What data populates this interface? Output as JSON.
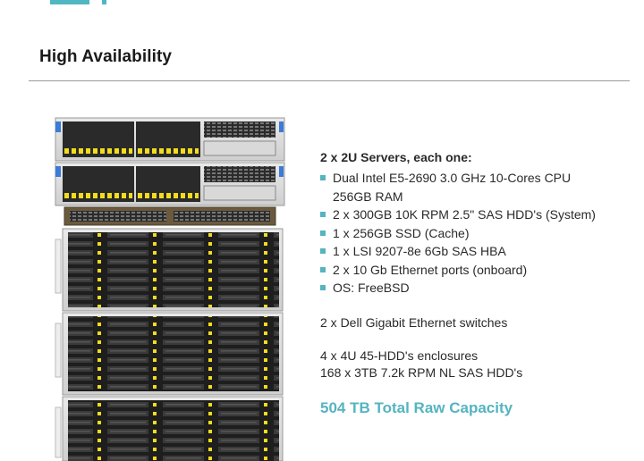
{
  "section_title": "High Availability",
  "servers": {
    "title": "2 x 2U Servers, each one:",
    "items": [
      {
        "line1": "Dual Intel E5-2690 3.0 GHz 10-Cores CPU",
        "line2": "256GB RAM"
      },
      {
        "line1": "2 x 300GB 10K RPM 2.5\" SAS HDD's (System)"
      },
      {
        "line1": "1 x 256GB SSD (Cache)"
      },
      {
        "line1": "1 x LSI 9207-8e 6Gb SAS HBA"
      },
      {
        "line1": "2 x 10 Gb Ethernet ports (onboard)"
      },
      {
        "line1": "OS: FreeBSD"
      }
    ]
  },
  "switches": "2 x Dell Gigabit Ethernet switches",
  "enclosures": {
    "line1": "4 x 4U 45-HDD's enclosures",
    "line2": "168 x 3TB 7.2k RPM NL SAS HDD's"
  },
  "capacity": "504 TB Total Raw Capacity",
  "colors": {
    "accent": "#55b4c0",
    "text": "#2a2a2a",
    "drive_led": "#f2dc1d"
  },
  "icons": [
    "server-rack-image",
    "bullet-square-icon"
  ]
}
